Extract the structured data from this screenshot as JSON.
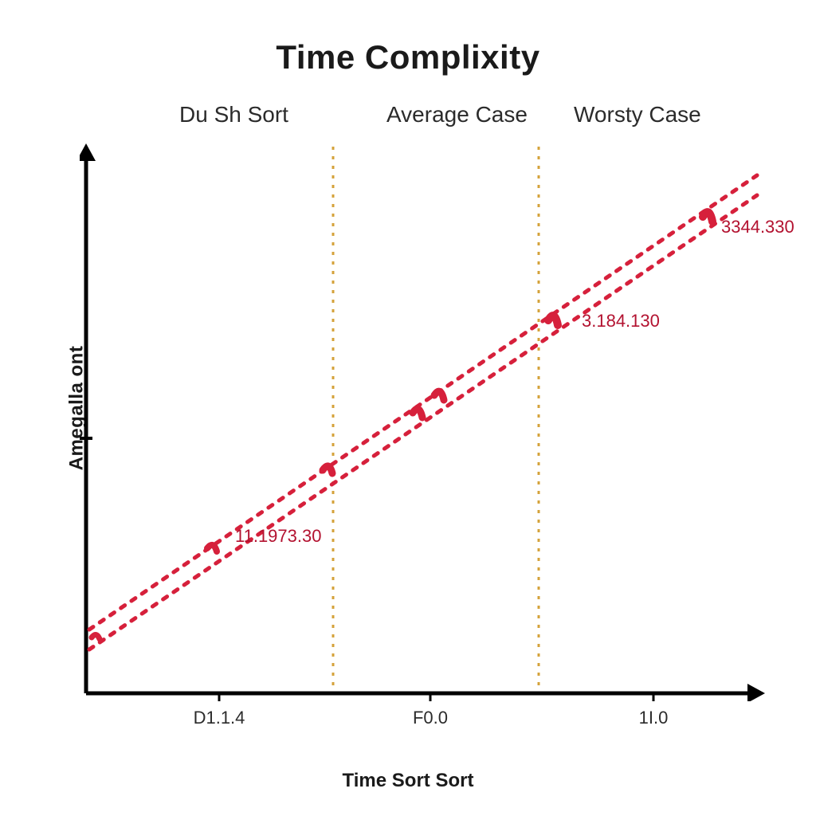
{
  "chart_data": {
    "type": "line",
    "title": "Time Complixity",
    "xlabel": "Time Sort Sort",
    "ylabel": "Amegalla ont",
    "regions": [
      "Du Sh Sort",
      "Average Case",
      "Worsty Case"
    ],
    "x_ticks": [
      "D1.1.4",
      "F0.0",
      "1I.0"
    ],
    "series": [
      {
        "name": "line-upper",
        "x": [
          0,
          100
        ],
        "y": [
          14,
          96
        ]
      },
      {
        "name": "line-lower",
        "x": [
          0,
          100
        ],
        "y": [
          10,
          92
        ]
      }
    ],
    "data_labels": [
      {
        "text": "11.1973.30",
        "x": 25,
        "y": 35
      },
      {
        "text": "3.184.130",
        "x": 72,
        "y": 68
      },
      {
        "text": "3344.330",
        "x": 94,
        "y": 85
      }
    ],
    "xlim": [
      0,
      100
    ],
    "ylim": [
      0,
      100
    ],
    "vertical_dividers_x": [
      37,
      67
    ],
    "colors": {
      "line": "#d6203b",
      "divider": "#d4a23a",
      "axis": "#000000"
    }
  }
}
